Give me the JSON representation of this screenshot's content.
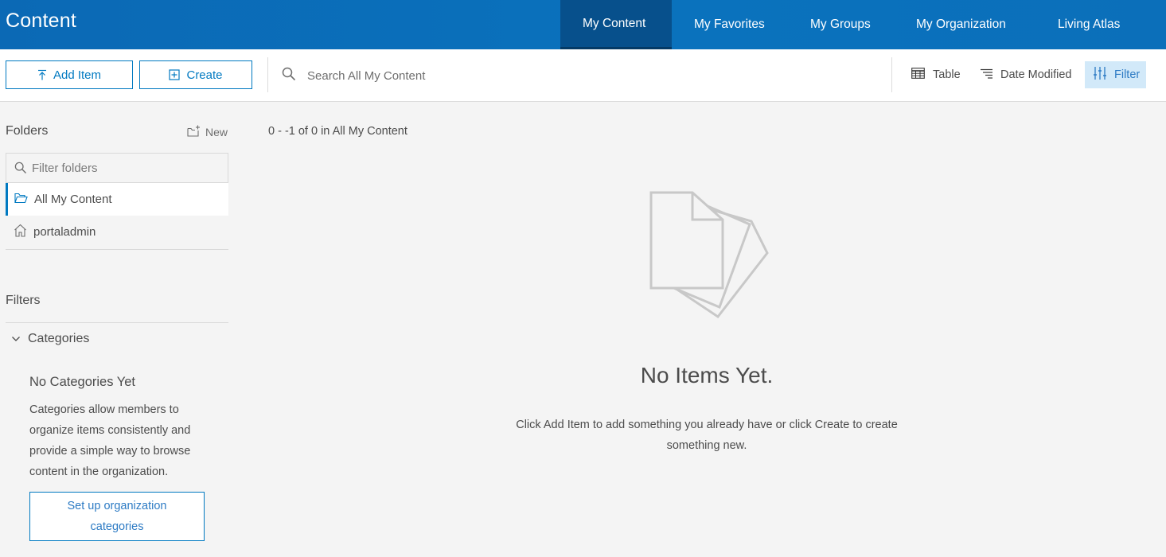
{
  "header": {
    "title": "Content",
    "tabs": [
      {
        "label": "My Content",
        "active": true
      },
      {
        "label": "My Favorites",
        "active": false
      },
      {
        "label": "My Groups",
        "active": false
      },
      {
        "label": "My Organization",
        "active": false
      },
      {
        "label": "Living Atlas",
        "active": false
      }
    ]
  },
  "toolbar": {
    "add_item_label": "Add Item",
    "create_label": "Create",
    "search_placeholder": "Search All My Content",
    "view_label": "Table",
    "sort_label": "Date Modified",
    "filter_label": "Filter"
  },
  "sidebar": {
    "folders_heading": "Folders",
    "new_folder_label": "New",
    "filter_placeholder": "Filter folders",
    "folders": [
      {
        "label": "All My Content",
        "icon": "folder-open-icon",
        "selected": true
      },
      {
        "label": "portaladmin",
        "icon": "home-icon",
        "selected": false
      }
    ],
    "filters_heading": "Filters",
    "categories_label": "Categories",
    "no_categories_title": "No Categories Yet",
    "no_categories_desc": "Categories allow members to organize items consistently and provide a simple way to browse content in the organization.",
    "setup_button_label": "Set up organization categories"
  },
  "main": {
    "results_count": "0 - -1 of 0 in All My Content",
    "empty_title": "No Items Yet.",
    "empty_desc": "Click Add Item to add something you already have or click Create to create something new."
  },
  "colors": {
    "header_bg": "#0b6fba",
    "active_tab_bg": "#07508c",
    "accent": "#0079c1",
    "filter_active_bg": "#d2e9f9",
    "page_bg": "#f4f4f4"
  }
}
